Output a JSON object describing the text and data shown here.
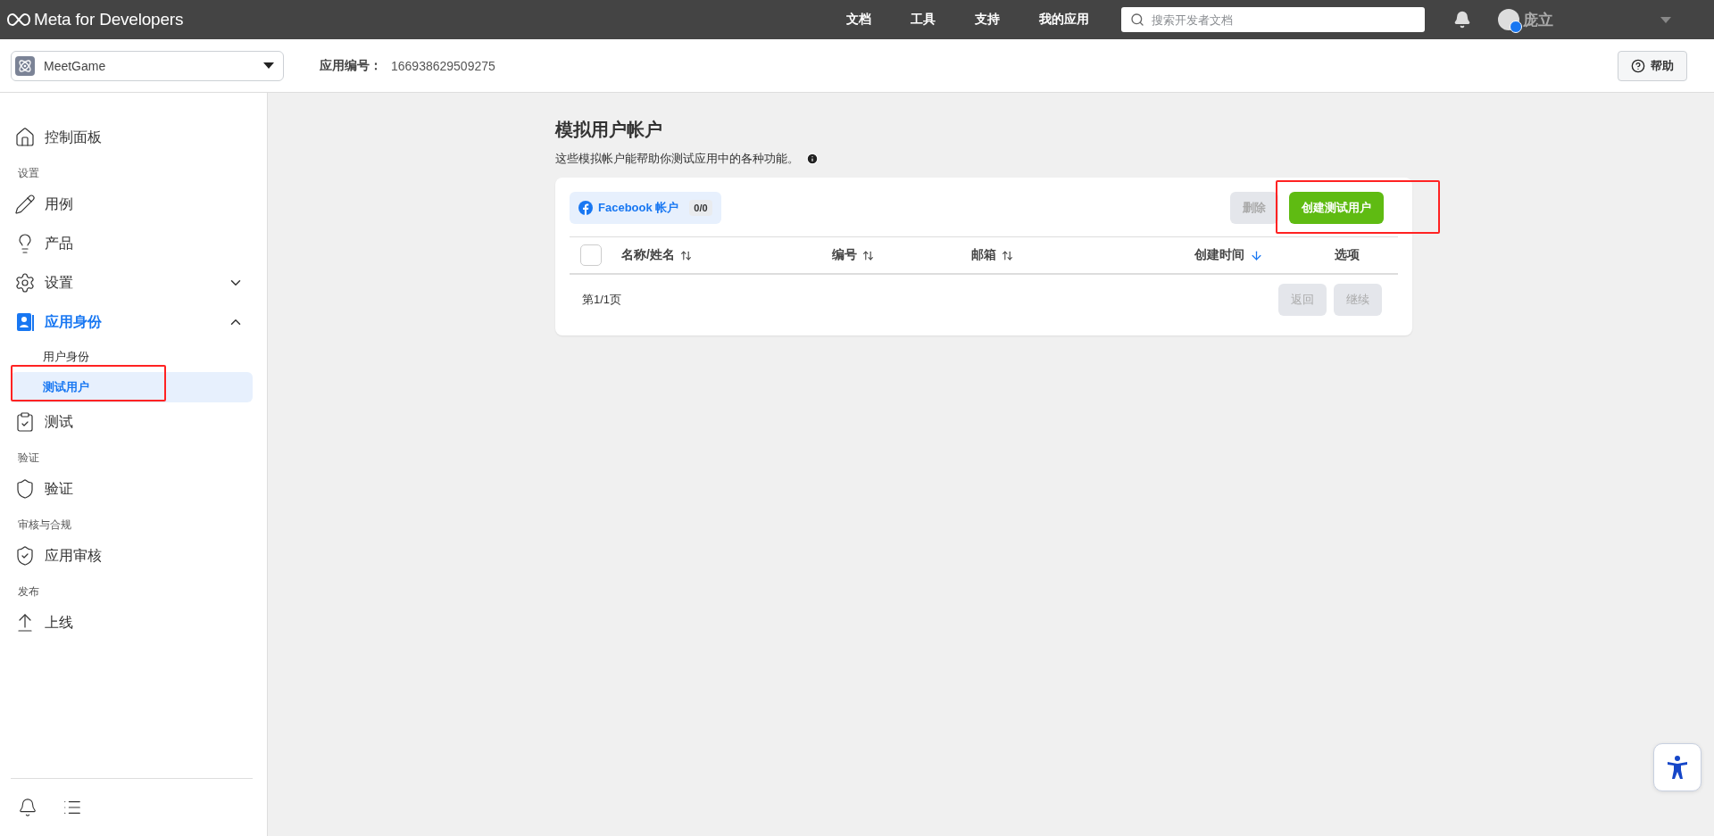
{
  "topbar": {
    "logo": "Meta for Developers",
    "nav": [
      "文档",
      "工具",
      "支持",
      "我的应用"
    ],
    "search": {
      "placeholder": "搜索开发者文档"
    },
    "user": "庞立"
  },
  "appbar": {
    "app_name": "MeetGame",
    "app_id_label": "应用编号：",
    "app_id": "166938629509275",
    "help": "帮助"
  },
  "sidebar": {
    "items": [
      {
        "kind": "link",
        "label": "控制面板",
        "selected": false
      },
      {
        "kind": "section",
        "label": "设置"
      },
      {
        "kind": "link",
        "label": "用例",
        "selected": false
      },
      {
        "kind": "link",
        "label": "产品",
        "selected": false
      },
      {
        "kind": "group",
        "label": "设置",
        "selected": false,
        "expanded": false
      },
      {
        "kind": "group",
        "label": "应用身份",
        "selected": true,
        "expanded": true,
        "children": [
          {
            "label": "用户身份",
            "selected": false,
            "highlighted": false
          },
          {
            "label": "测试用户",
            "selected": true,
            "highlighted": true
          }
        ]
      },
      {
        "kind": "link",
        "label": "测试",
        "selected": false
      },
      {
        "kind": "section",
        "label": "验证"
      },
      {
        "kind": "link",
        "label": "验证",
        "selected": false
      },
      {
        "kind": "section",
        "label": "审核与合规"
      },
      {
        "kind": "link",
        "label": "应用审核",
        "selected": false
      },
      {
        "kind": "section",
        "label": "发布"
      },
      {
        "kind": "link",
        "label": "上线",
        "selected": false
      }
    ]
  },
  "main": {
    "title": "模拟用户帐户",
    "description": "这些模拟帐户能帮助你测试应用中的各种功能。",
    "card": {
      "tab": {
        "label": "Facebook 帐户",
        "count": "0/0",
        "selected": true
      },
      "buttons": [
        {
          "label": "删除",
          "kind": "secondary",
          "disabled": true,
          "highlighted": false
        },
        {
          "label": "创建测试用户",
          "kind": "primary",
          "disabled": false,
          "highlighted": true
        }
      ],
      "select_all": {
        "checked": false
      },
      "columns": [
        {
          "kind": "sortable",
          "label": "名称/姓名",
          "sorted": false
        },
        {
          "kind": "sortable",
          "label": "编号",
          "sorted": false
        },
        {
          "kind": "sortable",
          "label": "邮箱",
          "sorted": false
        },
        {
          "kind": "sortable",
          "label": "创建时间",
          "sorted": true
        },
        {
          "kind": "plain",
          "label": "选项"
        }
      ],
      "page": "第1/1页",
      "pager": [
        {
          "label": "返回",
          "disabled": true
        },
        {
          "label": "继续",
          "disabled": true
        }
      ]
    }
  }
}
